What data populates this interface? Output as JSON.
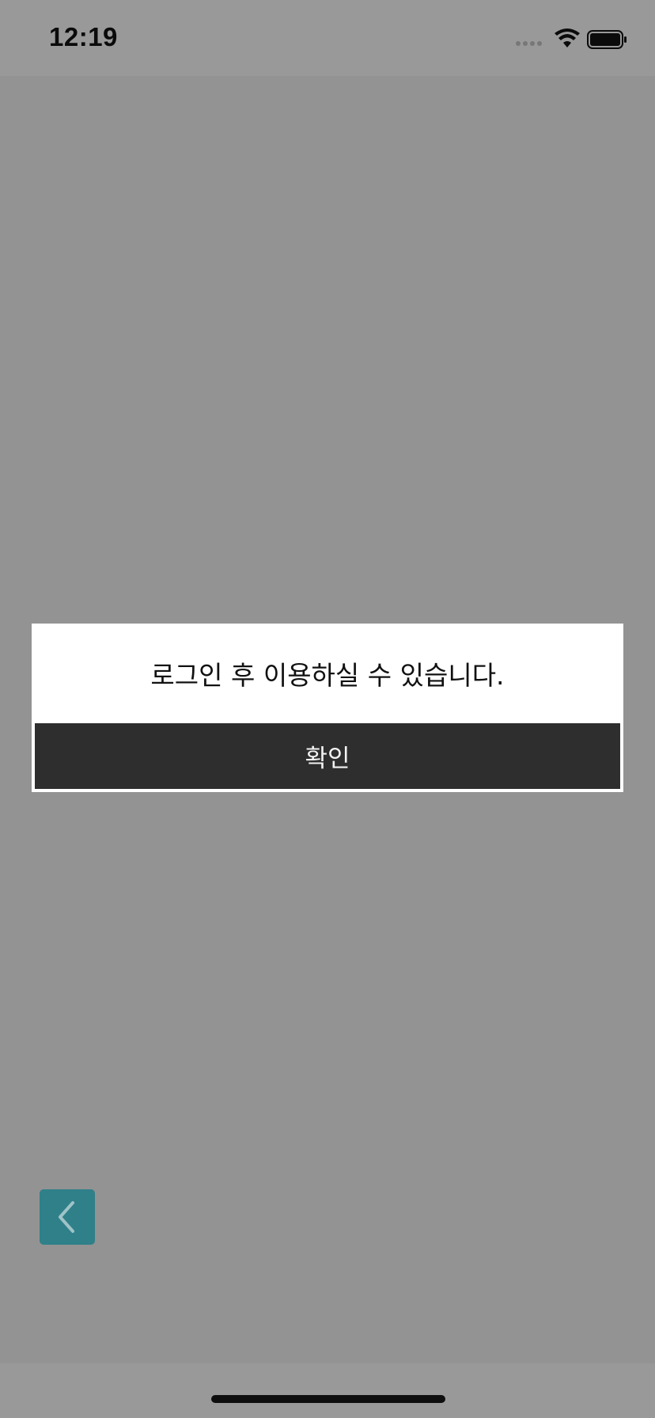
{
  "status_bar": {
    "time": "12:19",
    "icons": [
      "signal-icon",
      "wifi-icon",
      "battery-icon"
    ]
  },
  "dialog": {
    "message": "로그인 후 이용하실 수 있습니다.",
    "confirm_label": "확인"
  },
  "navigation": {
    "back_icon": "chevron-left-icon"
  },
  "colors": {
    "overlay": "#939393",
    "dialog_bg": "#ffffff",
    "confirm_bg": "#2e2e2e",
    "back_button_bg": "#2f8089"
  }
}
